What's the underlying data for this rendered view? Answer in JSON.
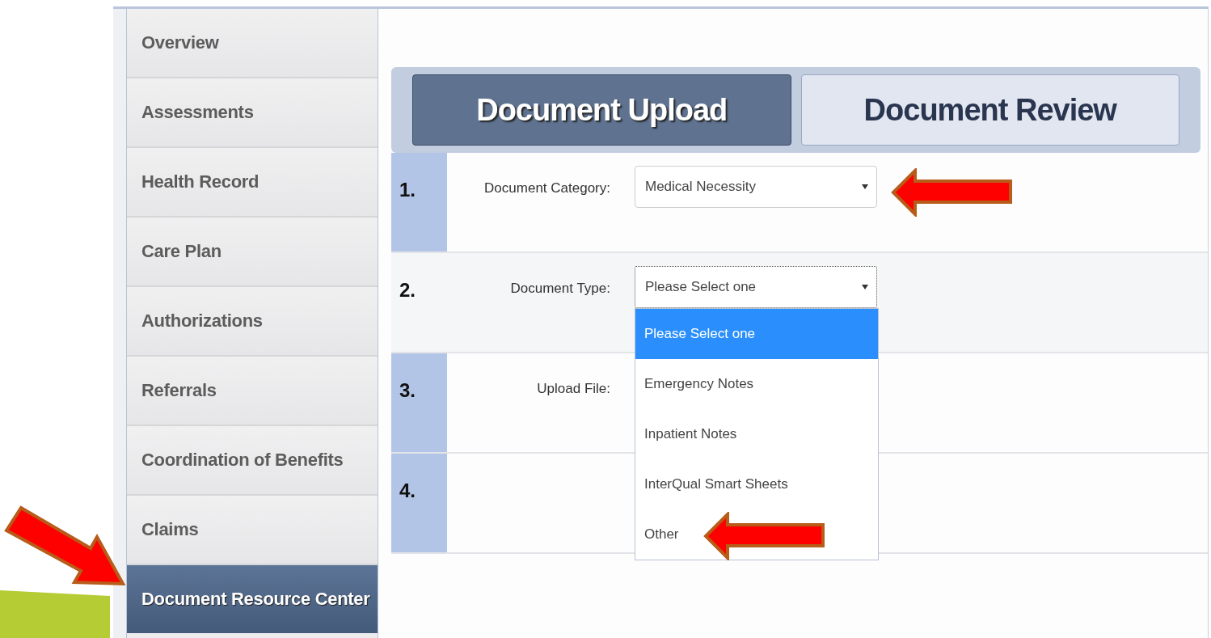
{
  "sidebar": {
    "items": [
      {
        "label": "Overview",
        "selected": false
      },
      {
        "label": "Assessments",
        "selected": false
      },
      {
        "label": "Health Record",
        "selected": false
      },
      {
        "label": "Care Plan",
        "selected": false
      },
      {
        "label": "Authorizations",
        "selected": false
      },
      {
        "label": "Referrals",
        "selected": false
      },
      {
        "label": "Coordination of Benefits",
        "selected": false
      },
      {
        "label": "Claims",
        "selected": false
      },
      {
        "label": "Document Resource Center",
        "selected": true
      }
    ]
  },
  "tabs": [
    {
      "label": "Document Upload",
      "selected": true
    },
    {
      "label": "Document Review",
      "selected": false
    }
  ],
  "steps": [
    {
      "number": "1.",
      "label": "Document Category:",
      "kind": "select",
      "value": "Medical Necessity",
      "focused": false
    },
    {
      "number": "2.",
      "label": "Document Type:",
      "kind": "select",
      "value": "Please Select one",
      "focused": true,
      "expanded": true,
      "options": [
        {
          "label": "Please Select one",
          "selected": true
        },
        {
          "label": "Emergency Notes",
          "selected": false
        },
        {
          "label": "Inpatient Notes",
          "selected": false
        },
        {
          "label": "InterQual Smart Sheets",
          "selected": false
        },
        {
          "label": "Other",
          "selected": false
        }
      ]
    },
    {
      "number": "3.",
      "label": "Upload File:",
      "kind": "file"
    },
    {
      "number": "4.",
      "kind": "blank"
    }
  ]
}
